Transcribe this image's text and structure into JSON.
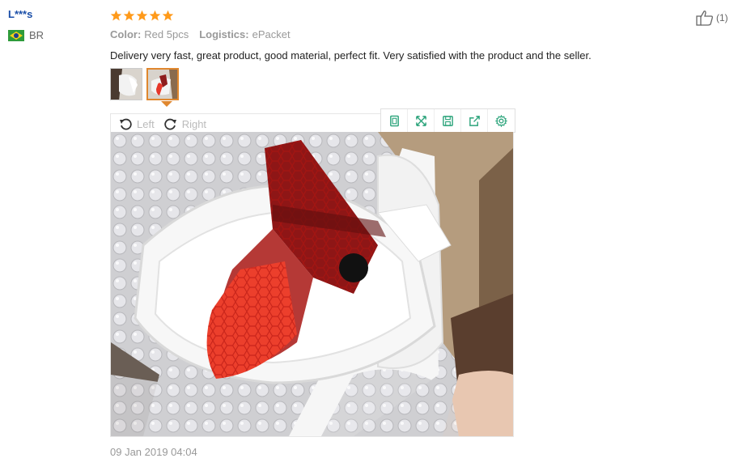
{
  "reviewer": {
    "name": "L***s",
    "country": "BR",
    "flag_icon": "brazil-flag-icon"
  },
  "review": {
    "rating": 5,
    "color_label": "Color:",
    "color_value": "Red 5pcs",
    "logistics_label": "Logistics:",
    "logistics_value": "ePacket",
    "text": "Delivery very fast, great product, good material, perfect fit. Very satisfied with the product and the seller.",
    "date": "09 Jan 2019 04:04"
  },
  "helpful": {
    "count": "(1)",
    "icon": "thumbs-up-icon"
  },
  "viewer": {
    "rotate_left": "Left",
    "rotate_right": "Right",
    "tools": [
      "fit-screen-icon",
      "fullscreen-icon",
      "save-icon",
      "share-icon",
      "settings-icon"
    ],
    "selected_thumbnail": 2
  },
  "colors": {
    "star": "#ff9a1a",
    "active_border": "#e0872e",
    "toolbar_icon": "#2aa37a",
    "reviewer_name": "#1a4ea8"
  }
}
